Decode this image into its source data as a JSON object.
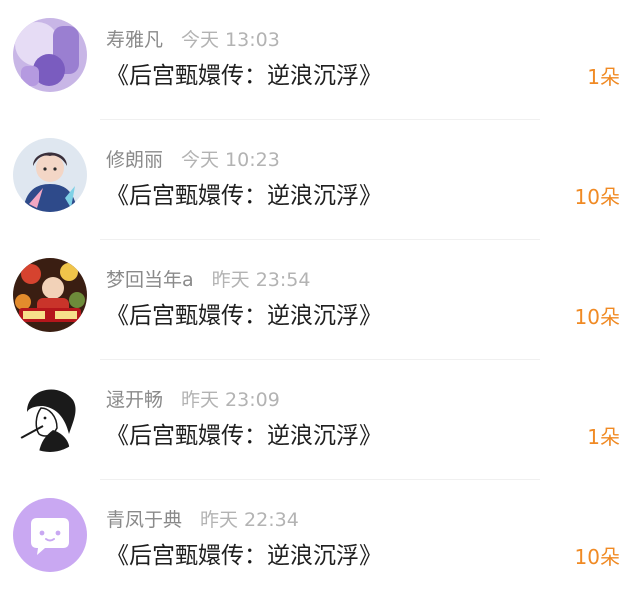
{
  "items": [
    {
      "username": "寿雅凡",
      "time": "今天 13:03",
      "title": "《后宫甄嬛传：逆浪沉浮》",
      "flowers": "1朵"
    },
    {
      "username": "修朗丽",
      "time": "今天 10:23",
      "title": "《后宫甄嬛传：逆浪沉浮》",
      "flowers": "10朵"
    },
    {
      "username": "梦回当年a",
      "time": "昨天 23:54",
      "title": "《后宫甄嬛传：逆浪沉浮》",
      "flowers": "10朵"
    },
    {
      "username": "逯开畅",
      "time": "昨天 23:09",
      "title": "《后宫甄嬛传：逆浪沉浮》",
      "flowers": "1朵"
    },
    {
      "username": "青凤于典",
      "time": "昨天 22:34",
      "title": "《后宫甄嬛传：逆浪沉浮》",
      "flowers": "10朵"
    }
  ],
  "colors": {
    "accent": "#f08a24",
    "name": "#8a8a8a",
    "time": "#b3b3b3",
    "title": "#1f1f1f",
    "divider": "#f0f0f0",
    "avatar_default": "#c9a8f2"
  }
}
